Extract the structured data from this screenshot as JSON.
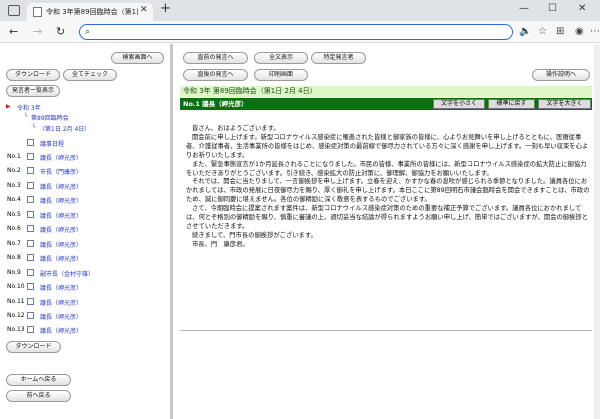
{
  "browser": {
    "tab_title": "令和 3年第89回臨時会（第1日 2",
    "tab_close": "✕",
    "newtab": "+",
    "win_min": "—",
    "win_max": "☐",
    "win_close": "✕",
    "nav_back": "←",
    "nav_forward": "→",
    "nav_reload": "↻",
    "url_text": ""
  },
  "left": {
    "search_button": "検索画面へ",
    "download_button": "ダウンロード",
    "check_all_button": "全てチェック",
    "speaker_list_button": "発言者一覧表示",
    "tree_era": "令和 3年",
    "tree_session": "第89回臨時会",
    "tree_day": "（第1日 2月 4日）",
    "tree_agenda": "議事日程",
    "speakers": [
      {
        "no": "No.1",
        "name": "議長（岬光彦）"
      },
      {
        "no": "No.2",
        "name": "市長（門康彦）"
      },
      {
        "no": "No.3",
        "name": "議長（岬光彦）"
      },
      {
        "no": "No.4",
        "name": "議長（岬光彦）"
      },
      {
        "no": "No.5",
        "name": "議長（岬光彦）"
      },
      {
        "no": "No.6",
        "name": "議長（岬光彦）"
      },
      {
        "no": "No.7",
        "name": "議長（岬光彦）"
      },
      {
        "no": "No.8",
        "name": "議長（岬光彦）"
      },
      {
        "no": "No.9",
        "name": "副市長（金村守雄）"
      },
      {
        "no": "No.10",
        "name": "議長（岬光彦）"
      },
      {
        "no": "No.11",
        "name": "議長（岬光彦）"
      },
      {
        "no": "No.12",
        "name": "議長（岬光彦）"
      },
      {
        "no": "No.13",
        "name": "議長（岬光彦）"
      }
    ],
    "download_button_2": "ダウンロード",
    "home_button": "ホームへ戻る",
    "back_button": "前へ戻る"
  },
  "right": {
    "prev_speech": "直前の発言へ",
    "show_all": "全文表示",
    "specific_speaker": "特定発言者",
    "next_speech": "直後の発言へ",
    "print_screen": "印刷画面",
    "help": "操作説明へ",
    "session_header": "令和 3年 第89回臨時会（第1日 2月 4日）",
    "speaker_header": "No.1 議長（岬光彦）",
    "smaller_text": "文字を小さく",
    "normal_text": "標準に戻す",
    "larger_text": "文字を大きく",
    "paragraphs": [
      "皆さん、おはようございます。",
      "開会前に申し上げます。新型コロナウイルス感染症に罹患された皆様と御家族の皆様に、心よりお見舞いを申し上げるとともに、医療従事者、介護従事者、生活事業所の皆様をはじめ、感染症対策の最前線で御尽力されている方々に深く感謝を申し上げます。一刻も早い収束を心よりお祈りいたします。",
      "また、緊急事態宣言が1か月延長されることになりました。市民の皆様、事業所の皆様には、新型コロナウイルス感染症の拡大防止に御協力をいただきありがとうございます。引き続き、感染拡大の防止対策に、御理解、御協力をお願いいたします。",
      "それでは、開会に当たりまして、一言御挨拶を申し上げます。立春を迎え、かすかな春の息吹が感じられる季節となりました。議員各位におかれましては、市政の発展に日夜御尽力を賜り、厚く御礼を申し上げます。本日ここに第89回明石市議会臨時会を開会できますことは、市政のため、誠に御同慶に堪えません。各位の御精励に深く敬意を表するものでございます。",
      "さて、今期臨時会に提案されます案件は、新型コロナウイルス感染症対策のための重要な補正予算でございます。議員各位におかれましては、何とぞ格別の御精励を賜り、慎重に審議の上、適切妥当な結論が得られますようお願い申し上げ、簡単ではございますが、開会の御挨拶とさせていただきます。",
      "続きまして、門市長の御挨拶がございます。",
      "市長、門　康彦君。"
    ]
  }
}
